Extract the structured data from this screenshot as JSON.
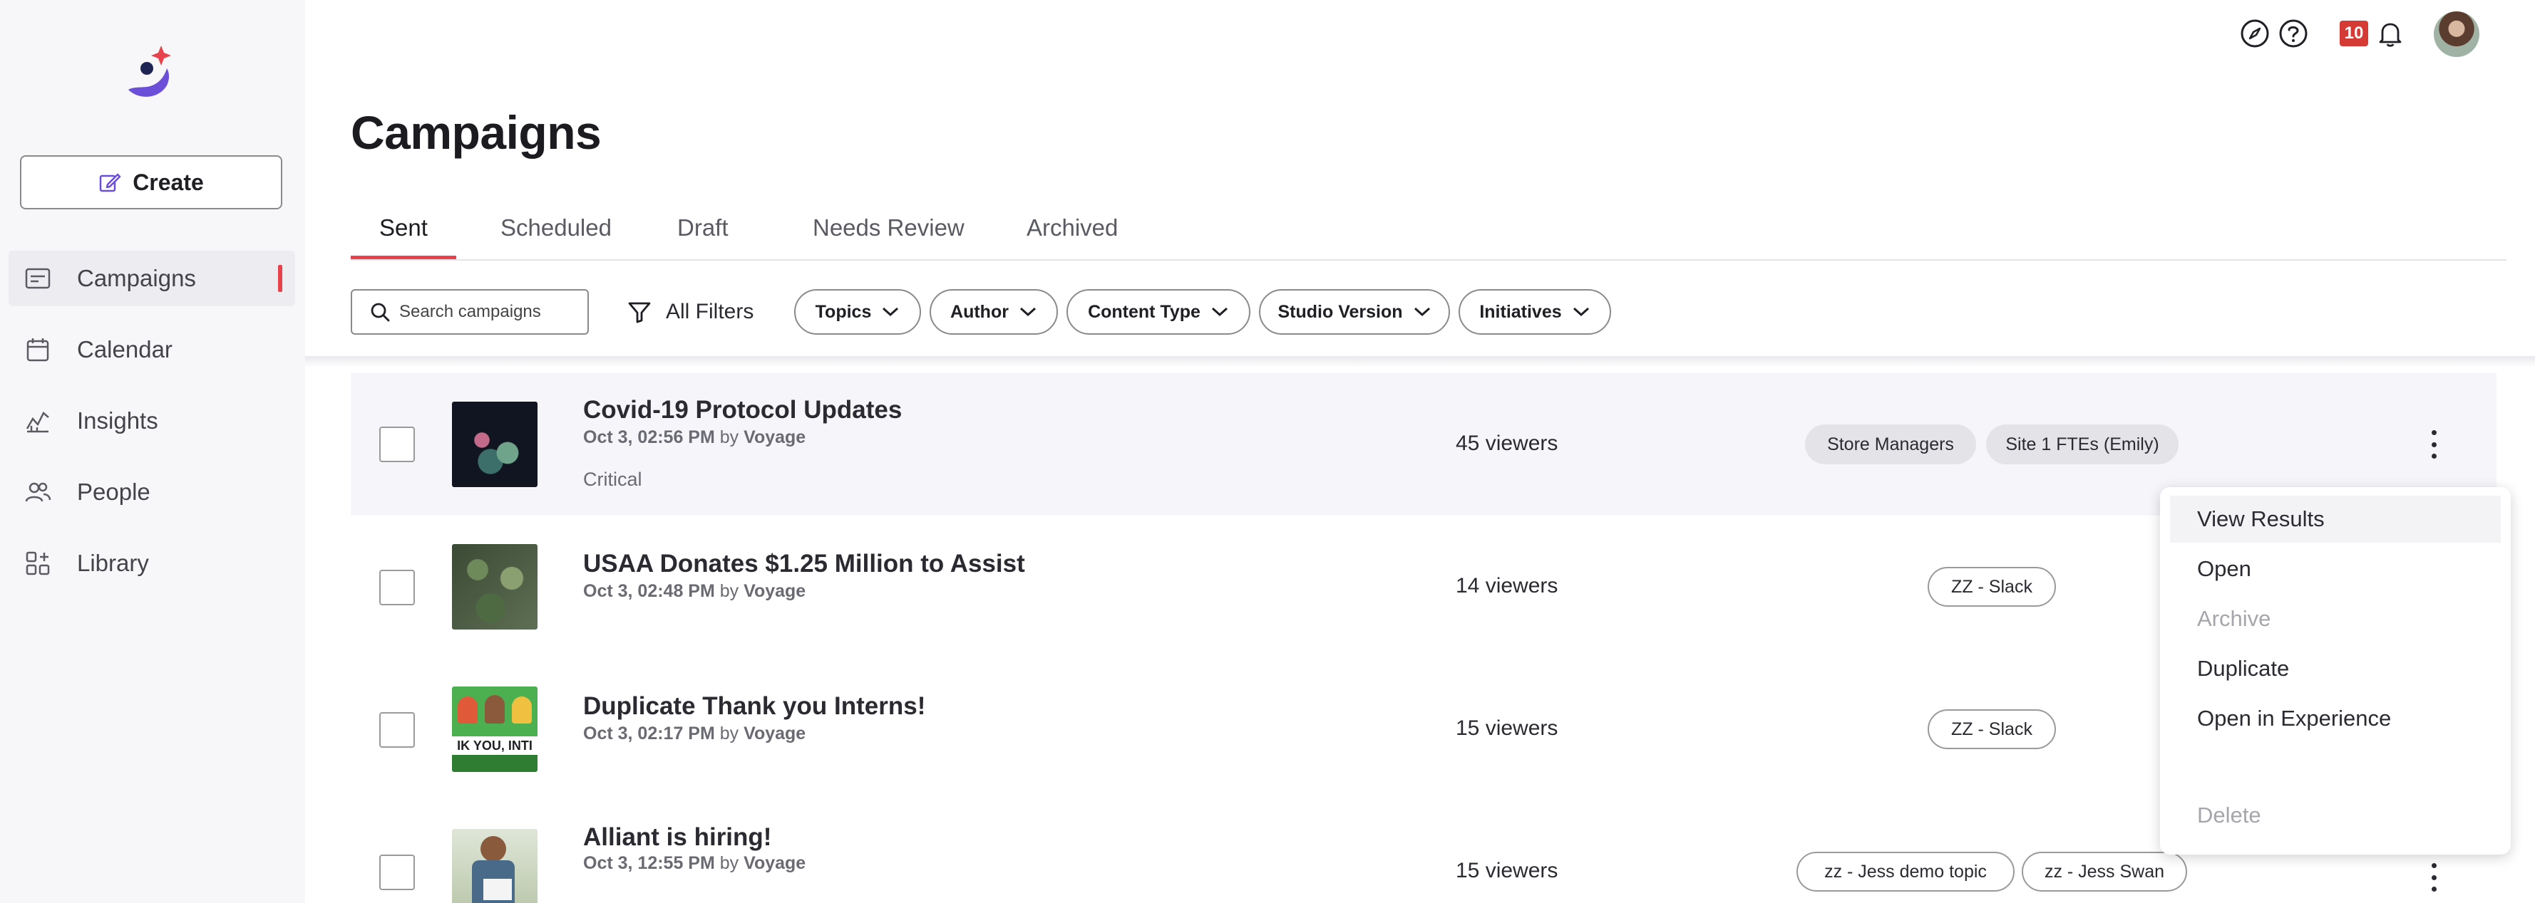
{
  "sidebar": {
    "create_label": "Create",
    "items": [
      {
        "label": "Campaigns"
      },
      {
        "label": "Calendar"
      },
      {
        "label": "Insights"
      },
      {
        "label": "People"
      },
      {
        "label": "Library"
      }
    ]
  },
  "topbar": {
    "notification_count": "10"
  },
  "page": {
    "title": "Campaigns"
  },
  "tabs": [
    {
      "label": "Sent"
    },
    {
      "label": "Scheduled"
    },
    {
      "label": "Draft"
    },
    {
      "label": "Needs Review"
    },
    {
      "label": "Archived"
    }
  ],
  "filters": {
    "search_placeholder": "Search campaigns",
    "all_filters_label": "All Filters",
    "chips": [
      {
        "label": "Topics"
      },
      {
        "label": "Author"
      },
      {
        "label": "Content Type"
      },
      {
        "label": "Studio Version"
      },
      {
        "label": "Initiatives"
      }
    ]
  },
  "campaigns": [
    {
      "title": "Covid-19 Protocol Updates",
      "date": "Oct 3, 02:56 PM",
      "by": "by",
      "author": "Voyage",
      "tag": "Critical",
      "viewers": "45 viewers",
      "audiences": [
        "Store Managers",
        "Site 1 FTEs (Emily)"
      ]
    },
    {
      "title": "USAA Donates $1.25 Million to Assist",
      "date": "Oct 3, 02:48 PM",
      "by": "by",
      "author": "Voyage",
      "viewers": "14 viewers",
      "audiences": [
        "ZZ - Slack"
      ]
    },
    {
      "title": "Duplicate Thank you Interns!",
      "date": "Oct 3, 02:17 PM",
      "by": "by",
      "author": "Voyage",
      "thumb_text": "IK YOU, INTI",
      "viewers": "15 viewers",
      "audiences": [
        "ZZ - Slack"
      ]
    },
    {
      "title": "Alliant is hiring!",
      "date": "Oct 3, 12:55 PM",
      "by": "by",
      "author": "Voyage",
      "viewers": "15 viewers",
      "audiences": [
        "zz - Jess demo topic",
        "zz - Jess Swan"
      ]
    }
  ],
  "context_menu": {
    "items": [
      {
        "label": "View Results",
        "state": "highlighted"
      },
      {
        "label": "Open",
        "state": "enabled"
      },
      {
        "label": "Archive",
        "state": "disabled"
      },
      {
        "label": "Duplicate",
        "state": "enabled"
      },
      {
        "label": "Open in Experience",
        "state": "enabled"
      },
      {
        "label": "Delete",
        "state": "disabled"
      }
    ]
  },
  "colors": {
    "accent": "#e8424c",
    "sidebar_bg": "#f7f7f9",
    "badge": "#d63a34",
    "brand_purple": "#6b4fd8",
    "brand_navy": "#1f2552"
  }
}
